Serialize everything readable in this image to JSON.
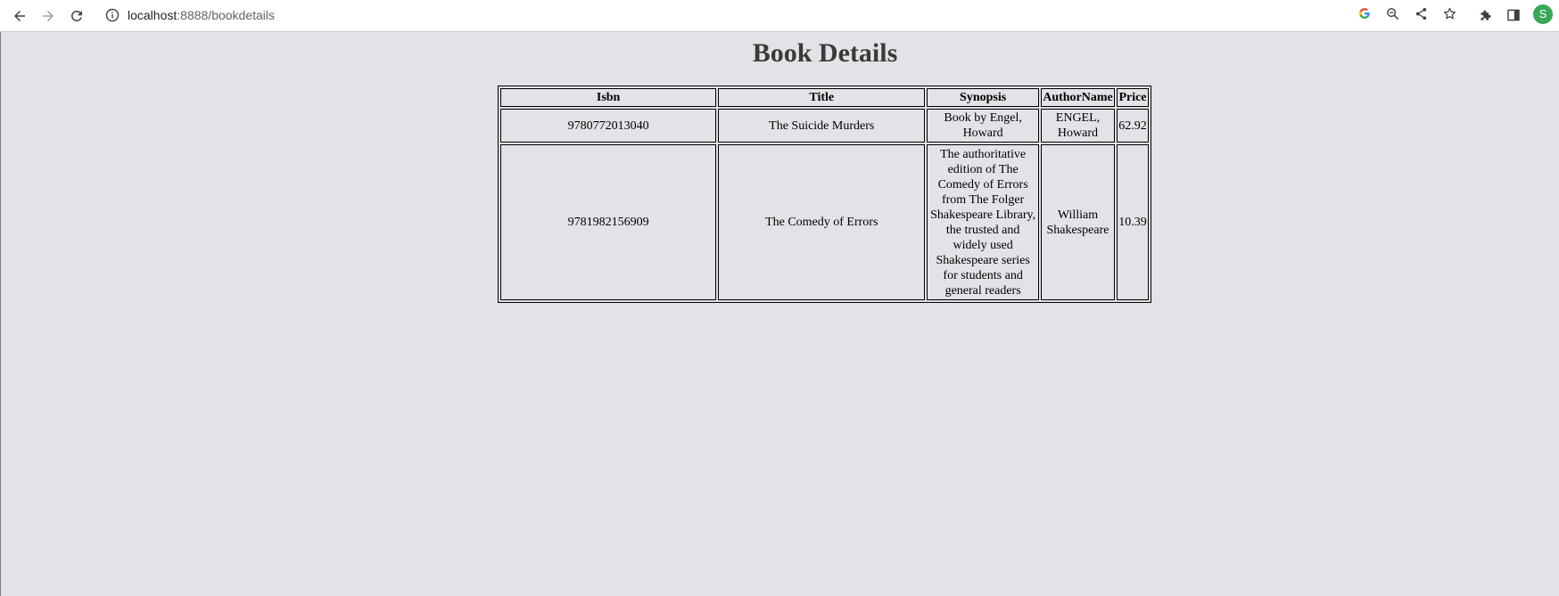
{
  "browser": {
    "url_host": "localhost",
    "url_rest": ":8888/bookdetails",
    "profile_initial": "S",
    "icons": [
      "back-arrow-icon",
      "forward-arrow-icon",
      "reload-icon",
      "site-info-icon",
      "google-icon",
      "zoom-out-icon",
      "share-icon",
      "bookmark-star-icon",
      "extensions-puzzle-icon",
      "side-panel-icon"
    ]
  },
  "page": {
    "title": "Book Details",
    "columns": [
      "Isbn",
      "Title",
      "Synopsis",
      "AuthorName",
      "Price"
    ],
    "rows": [
      {
        "isbn": "9780772013040",
        "title": "The Suicide Murders",
        "synopsis": "Book by Engel, Howard",
        "author": "ENGEL, Howard",
        "price": "62.92"
      },
      {
        "isbn": "9781982156909",
        "title": "The Comedy of Errors",
        "synopsis": "The authoritative edition of The Comedy of Errors from The Folger Shakespeare Library, the trusted and widely used Shakespeare series for students and general readers",
        "author": "William Shakespeare",
        "price": "10.39"
      }
    ]
  },
  "colors": {
    "page_background": "#e3e2e7",
    "title_color": "#3a3a3a",
    "profile_avatar": "#3aa757"
  }
}
